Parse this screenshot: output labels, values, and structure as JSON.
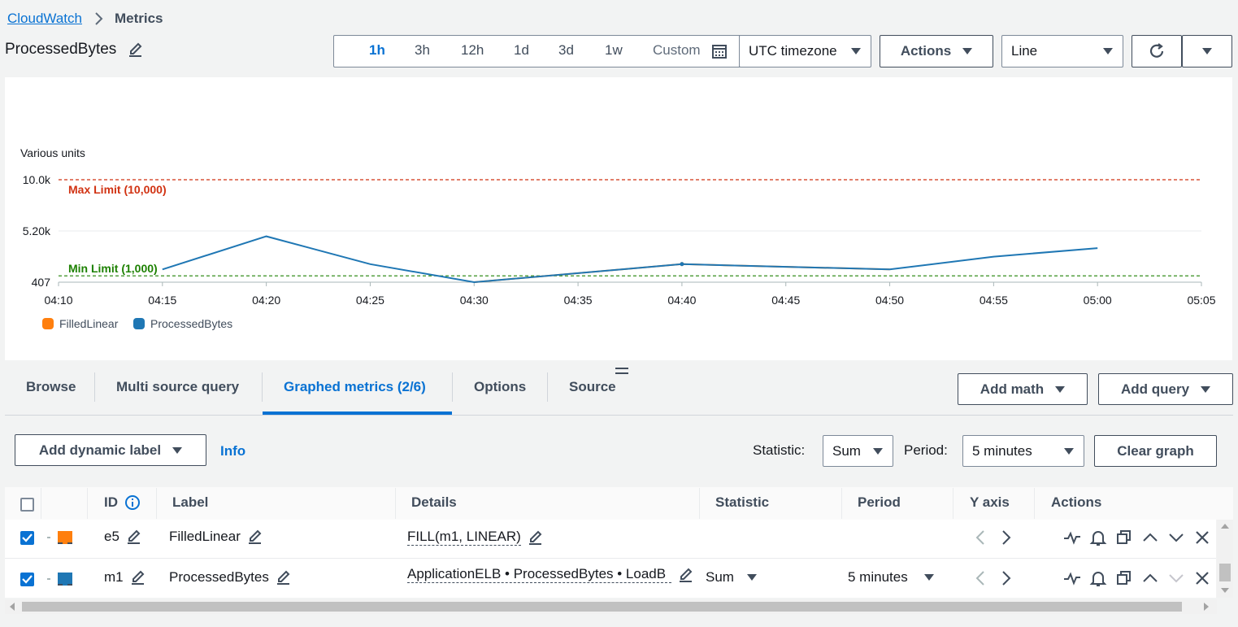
{
  "breadcrumb": {
    "root": "CloudWatch",
    "current": "Metrics"
  },
  "page": {
    "title": "ProcessedBytes"
  },
  "time_ranges": [
    "1h",
    "3h",
    "12h",
    "1d",
    "3d",
    "1w"
  ],
  "time_active": "1h",
  "custom_label": "Custom",
  "timezone": "UTC timezone",
  "actions_label": "Actions",
  "graph_type": "Line",
  "chart_data": {
    "type": "line",
    "ylabel": "Various units",
    "y_ticks": [
      "10.0k",
      "5.20k",
      "407"
    ],
    "ylim": [
      407,
      10000
    ],
    "x_ticks": [
      "04:10",
      "04:15",
      "04:20",
      "04:25",
      "04:30",
      "04:35",
      "04:40",
      "04:45",
      "04:50",
      "04:55",
      "05:00",
      "05:05"
    ],
    "x_minutes": [
      0,
      5,
      10,
      15,
      20,
      25,
      30,
      35,
      40,
      45,
      50,
      55
    ],
    "series": [
      {
        "name": "FilledLinear",
        "color": "#ff7f0e",
        "x": [
          "04:30",
          "04:40",
          "04:50"
        ],
        "y": [
          407,
          2100,
          1600
        ]
      },
      {
        "name": "ProcessedBytes",
        "color": "#1f77b4",
        "x": [
          "04:15",
          "04:20",
          "04:25",
          "04:30",
          "04:40",
          "04:50",
          "04:55",
          "05:00"
        ],
        "y": [
          1600,
          4700,
          2100,
          407,
          2100,
          1600,
          2800,
          3600
        ]
      }
    ],
    "annotations": [
      {
        "label": "Max Limit (10,000)",
        "value": 10000,
        "color": "#d13212"
      },
      {
        "label": "Min Limit (1,000)",
        "value": 1000,
        "color": "#1d8102"
      }
    ]
  },
  "tabs": [
    "Browse",
    "Multi source query",
    "Graphed metrics (2/6)",
    "Options",
    "Source"
  ],
  "active_tab": "Graphed metrics (2/6)",
  "add_math": "Add math",
  "add_query": "Add query",
  "dynamic_label": "Add dynamic label",
  "info": "Info",
  "statistic_label": "Statistic:",
  "statistic_value": "Sum",
  "period_label": "Period:",
  "period_value": "5 minutes",
  "clear_graph": "Clear graph",
  "table": {
    "headers": [
      "ID",
      "Label",
      "Details",
      "Statistic",
      "Period",
      "Y axis",
      "Actions"
    ],
    "rows": [
      {
        "id": "e5",
        "label": "FilledLinear",
        "details": "FILL(m1, LINEAR)",
        "statistic": "",
        "period": "",
        "color": "#ff7f0e"
      },
      {
        "id": "m1",
        "label": "ProcessedBytes",
        "details": "ApplicationELB • ProcessedBytes • LoadB",
        "statistic": "Sum",
        "period": "5 minutes",
        "color": "#1f77b4"
      }
    ]
  }
}
